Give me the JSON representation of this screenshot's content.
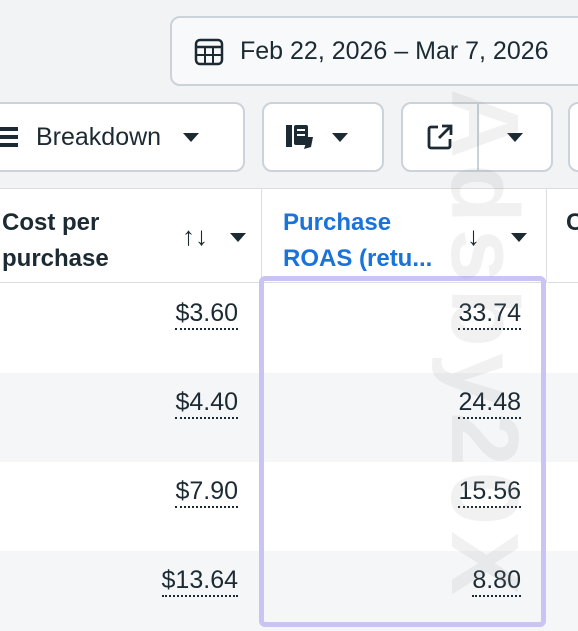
{
  "date_range": {
    "label": "Feb 22, 2026 – Mar 7, 2026",
    "icon": "calendar-icon"
  },
  "toolbar": {
    "breakdown_label": "Breakdown",
    "breakdown_icon": "list-icon",
    "reports_icon": "reports-icon",
    "export_icon": "export-icon"
  },
  "table": {
    "columns": [
      {
        "label_line1": "Cost per",
        "label_line2": "purchase",
        "sort_icon": "↑↓"
      },
      {
        "label_line1": "Purchase",
        "label_line2": "ROAS (retu...",
        "sort_icon": "↓"
      },
      {
        "label_line1": "C"
      }
    ],
    "rows": [
      {
        "cost_per_purchase": "$3.60",
        "purchase_roas": "33.74"
      },
      {
        "cost_per_purchase": "$4.40",
        "purchase_roas": "24.48"
      },
      {
        "cost_per_purchase": "$7.90",
        "purchase_roas": "15.56"
      },
      {
        "cost_per_purchase": "$13.64",
        "purchase_roas": "8.80"
      }
    ]
  },
  "watermark": "Adsby20X",
  "colors": {
    "accent": "#1a73d9",
    "highlight": "#c9c4f4"
  }
}
